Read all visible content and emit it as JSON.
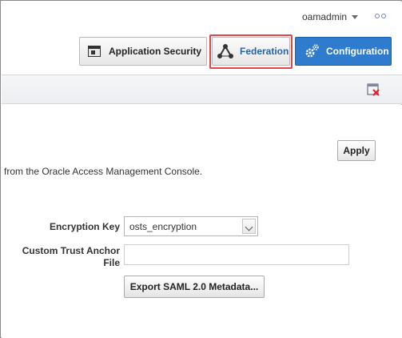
{
  "header": {
    "username": "oamadmin",
    "username_icon": "chevron-down-icon",
    "more_icon": "ellipsis-icon"
  },
  "launchpad": {
    "application_security": {
      "label": "Application Security",
      "icon": "window-icon"
    },
    "federation": {
      "label": "Federation",
      "icon": "federation-icon",
      "highlighted": true,
      "highlight_color": "#e0454a"
    },
    "configuration": {
      "label": "Configuration",
      "icon": "gears-icon",
      "background": "#2f7ccf"
    }
  },
  "toolbar": {
    "close_tab_icon": "close-tab-icon"
  },
  "main": {
    "apply_label": "Apply",
    "info_text": "from the Oracle Access Management Console.",
    "encryption_key_label": "Encryption Key",
    "encryption_key_value": "osts_encryption",
    "trust_anchor_label_line1": "Custom Trust Anchor",
    "trust_anchor_label_line2": "File",
    "trust_anchor_value": "",
    "export_label": "Export SAML 2.0 Metadata..."
  }
}
